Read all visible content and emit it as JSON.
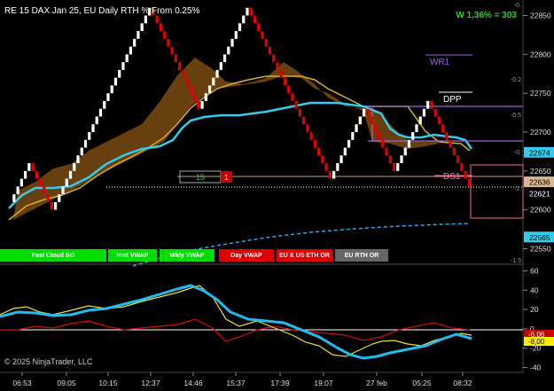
{
  "header": {
    "title": "RE 15 DAX Jan 25, EU Daily RTH % From 0.25%",
    "pnl": "W 1,36% = 303"
  },
  "levels": {
    "wr1": "WR1",
    "dpp": "DPP",
    "ds1": "DS1",
    "position_qty": "15",
    "position_close": "1"
  },
  "buttons": [
    {
      "label": "Fast Cloud BO",
      "color": "#00dd00"
    },
    {
      "label": "Hmt VWAP",
      "color": "#00dd00"
    },
    {
      "label": "Wkly VWAP",
      "color": "#00dd00"
    },
    {
      "label": "Day VWAP",
      "color": "#dd0000"
    },
    {
      "label": "EU & US ETH OR",
      "color": "#dd0000"
    },
    {
      "label": "EU RTH OR",
      "color": "#666666"
    }
  ],
  "copyright": "© 2025 NinjaTrader, LLC",
  "colors": {
    "up_brick": "#ffffff",
    "down_brick": "#e00000",
    "cloud": "#7a4a10",
    "cyan": "#33ccee",
    "gold": "#d4b020",
    "purple": "#9966dd",
    "pink": "#ff66aa"
  },
  "chart_data": [
    {
      "type": "renko",
      "price_axis": {
        "ticks": [
          22550,
          22600,
          22650,
          22700,
          22750,
          22800,
          22850
        ],
        "ylim": [
          22530,
          22870
        ]
      },
      "time_axis": {
        "ticks": [
          "06:53",
          "09:05",
          "10:15",
          "12:37",
          "14:46",
          "15:37",
          "17:39",
          "19:07",
          "27 feb",
          "05:25",
          "08:32"
        ]
      },
      "right_scale_labels": [
        "-0.",
        "-0.2",
        "-0.5",
        "-0.",
        "-1.",
        "-1.5"
      ],
      "price_badges": [
        {
          "value": "22674",
          "color": "cyan"
        },
        {
          "value": "22636",
          "color": "tan"
        },
        {
          "value": "22621",
          "color": "white"
        },
        {
          "value": "22565",
          "color": "cyan"
        }
      ],
      "bricks": [
        22610,
        22620,
        22630,
        22640,
        22650,
        22660,
        22650,
        22640,
        22630,
        22620,
        22610,
        22600,
        22610,
        22620,
        22630,
        22640,
        22650,
        22660,
        22670,
        22680,
        22690,
        22700,
        22710,
        22720,
        22730,
        22740,
        22750,
        22760,
        22770,
        22780,
        22790,
        22800,
        22810,
        22820,
        22830,
        22840,
        22850,
        22860,
        22850,
        22840,
        22830,
        22820,
        22810,
        22800,
        22790,
        22780,
        22770,
        22760,
        22750,
        22740,
        22730,
        22740,
        22750,
        22760,
        22770,
        22780,
        22790,
        22800,
        22810,
        22820,
        22830,
        22840,
        22850,
        22860,
        22850,
        22840,
        22830,
        22820,
        22810,
        22800,
        22790,
        22780,
        22770,
        22760,
        22750,
        22740,
        22730,
        22720,
        22710,
        22700,
        22690,
        22680,
        22670,
        22660,
        22650,
        22640,
        22650,
        22660,
        22670,
        22680,
        22690,
        22700,
        22710,
        22720,
        22730,
        22720,
        22710,
        22700,
        22690,
        22680,
        22670,
        22660,
        22650,
        22660,
        22670,
        22680,
        22690,
        22700,
        22710,
        22720,
        22730,
        22740,
        22730,
        22720,
        22710,
        22700,
        22690,
        22680,
        22670,
        22660,
        22650,
        22640,
        22630
      ]
    },
    {
      "type": "oscillator",
      "ylim": [
        -45,
        65
      ],
      "ticks": [
        60,
        40,
        20,
        0,
        -20,
        -40
      ],
      "current_badges": [
        "-6,06",
        "-8,00"
      ]
    }
  ]
}
